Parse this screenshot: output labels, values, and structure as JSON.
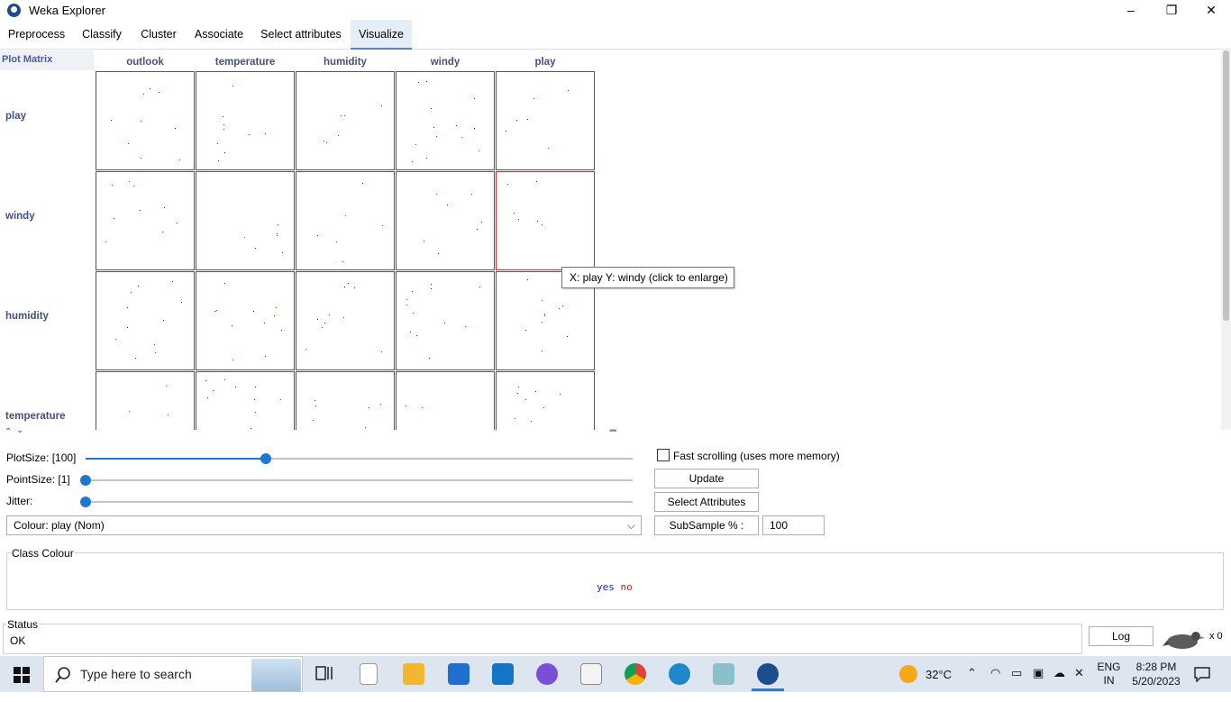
{
  "window": {
    "title": "Weka Explorer",
    "minimize": "–",
    "maximize": "❐",
    "close": "✕"
  },
  "tabs": [
    "Preprocess",
    "Classify",
    "Cluster",
    "Associate",
    "Select attributes",
    "Visualize"
  ],
  "active_tab": "Visualize",
  "matrix": {
    "corner": "Plot Matrix",
    "columns": [
      "outlook",
      "temperature",
      "humidity",
      "windy",
      "play"
    ],
    "rows": [
      "play",
      "windy",
      "humidity",
      "temperature"
    ],
    "selected_cell": {
      "row": "windy",
      "column": "play"
    }
  },
  "tooltip": "X: play Y: windy (click to enlarge)",
  "controls": {
    "plotsize_label": "PlotSize: [100]",
    "pointsize_label": "PointSize: [1]",
    "jitter_label": "Jitter:",
    "plotsize_fraction": 0.33,
    "pointsize_fraction": 0.0,
    "jitter_fraction": 0.0,
    "fast_scrolling_label": "Fast scrolling (uses more memory)",
    "fast_scrolling_checked": false,
    "update_label": "Update",
    "select_attributes_label": "Select Attributes",
    "colour_label": "Colour: play  (Nom)",
    "subsample_label": "SubSample % :",
    "subsample_value": "100"
  },
  "class_colour": {
    "title": "Class Colour",
    "entries": [
      {
        "label": "yes",
        "color": "#1a1ad8"
      },
      {
        "label": "no",
        "color": "#d81a1a"
      }
    ]
  },
  "status": {
    "title": "Status",
    "text": "OK",
    "log_label": "Log",
    "count": "x 0"
  },
  "taskbar": {
    "search_placeholder": "Type here to search",
    "weather": "32°C",
    "lang1": "ENG",
    "lang2": "IN",
    "time": "8:28 PM",
    "date": "5/20/2023"
  },
  "colors": {
    "yes": "#1a1ad8",
    "no": "#d81a1a",
    "accent": "#1e78d2",
    "header_text": "#46507e"
  }
}
